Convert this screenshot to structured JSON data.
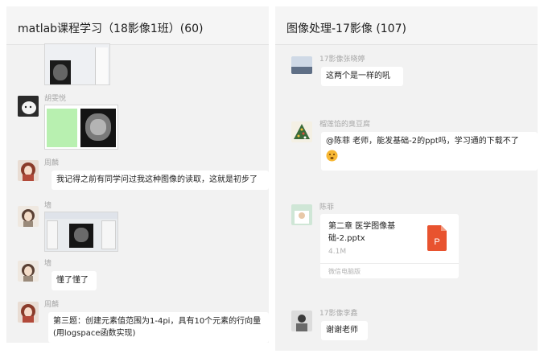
{
  "left_chat": {
    "title": "matlab课程学习（18影像1班）(60)",
    "messages": [
      {
        "sender": "胡雯悦"
      },
      {
        "sender": "周麟",
        "text": "我记得之前有同学问过我这种图像的读取，这就是初步了"
      },
      {
        "sender": "墙"
      },
      {
        "sender": "墙",
        "text": "懂了懂了"
      },
      {
        "sender": "周麟",
        "text": "第三题：创建元素值范围为1-4pi，具有10个元素的行向量(用logspace函数实现)"
      }
    ]
  },
  "right_chat": {
    "title": "图像处理-17影像 (107)",
    "messages": [
      {
        "sender": "17影像张晓婷",
        "text": "这两个是一样的吼"
      },
      {
        "sender": "榴莲馅的臭豆腐",
        "text": "@陈菲 老师，能发基础-2的ppt吗，学习通的下载不了"
      },
      {
        "sender": "陈菲",
        "file": {
          "name": "第二章 医学图像基础-2.pptx",
          "size": "4.1M",
          "source": "微信电脑版",
          "icon": "ppt-file-icon",
          "icon_label": "P"
        }
      },
      {
        "sender": "17影像李鑫",
        "text": "谢谢老师"
      }
    ]
  },
  "colors": {
    "panel_bg": "#f2f2f2",
    "bubble_bg": "#ffffff",
    "sender_text": "#a8a8a8",
    "ppt_icon": "#e8532f"
  }
}
